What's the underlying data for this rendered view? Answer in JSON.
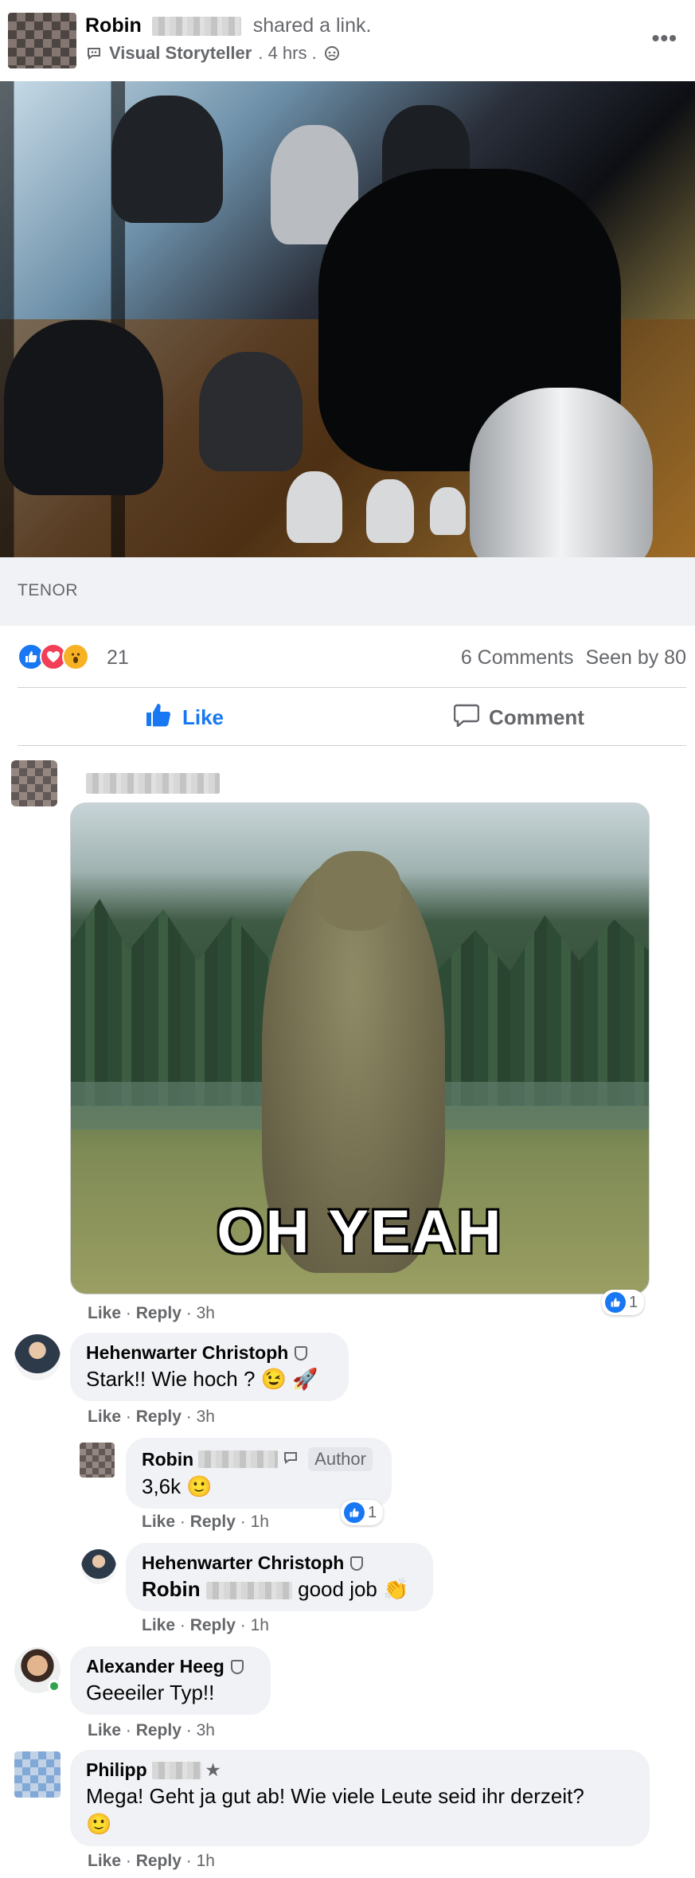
{
  "post": {
    "author_first": "Robin",
    "shared_text": "shared a link.",
    "badge": "Visual Storyteller",
    "time": ". 4 hrs .",
    "more": "•••"
  },
  "link": {
    "source": "TENOR"
  },
  "reactions": {
    "count": "21",
    "comments": "6 Comments",
    "seen": "Seen by 80",
    "like_label": "Like",
    "comment_label": "Comment"
  },
  "colors": {
    "accent": "#1877f2",
    "love": "#f33e58",
    "wow": "#f7b125",
    "bubble": "#f0f2f5",
    "secondary_text": "#65676b"
  },
  "comments": [
    {
      "gif_caption": "OH YEAH",
      "like": "Like",
      "reply": "Reply",
      "time": "3h",
      "reactions": "1"
    },
    {
      "author": "Hehenwarter Christoph",
      "text": "Stark!! Wie hoch ? 😉 🚀",
      "like": "Like",
      "reply": "Reply",
      "time": "3h"
    },
    {
      "author": "Robin",
      "author_badge": "Author",
      "text": "3,6k 🙂",
      "like": "Like",
      "reply": "Reply",
      "time": "1h",
      "reactions": "1"
    },
    {
      "author": "Hehenwarter Christoph",
      "mention": "Robin",
      "text": "good job 👏",
      "like": "Like",
      "reply": "Reply",
      "time": "1h"
    },
    {
      "author": "Alexander Heeg",
      "text": "Geeeiler Typ!!",
      "like": "Like",
      "reply": "Reply",
      "time": "3h"
    },
    {
      "author": "Philipp",
      "text": "Mega! Geht ja gut ab! Wie viele Leute seid ihr derzeit?",
      "emoji": "🙂",
      "like": "Like",
      "reply": "Reply",
      "time": "1h"
    }
  ]
}
